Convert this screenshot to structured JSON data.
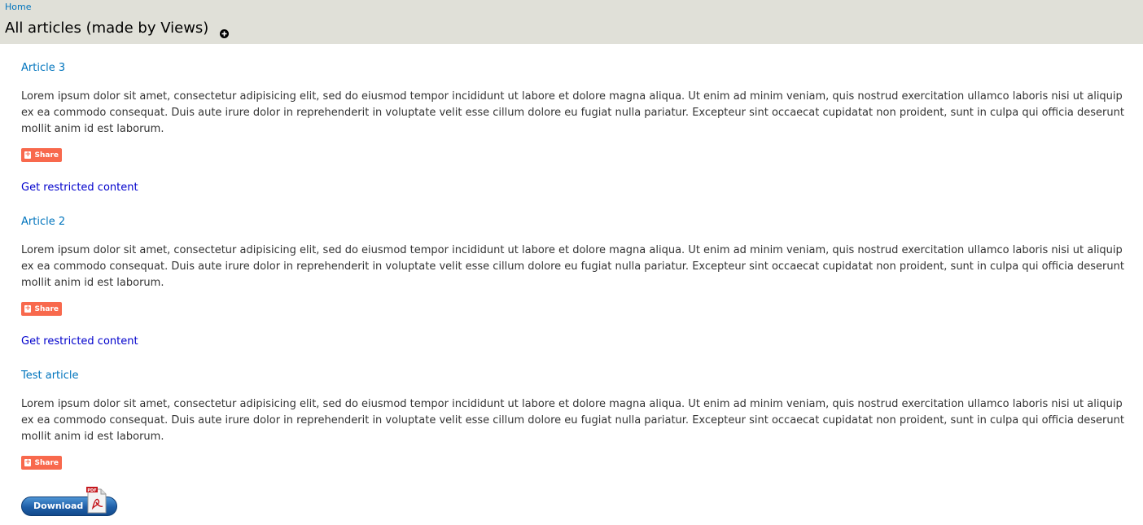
{
  "breadcrumb": {
    "home": "Home"
  },
  "page": {
    "title": "All articles (made by Views)"
  },
  "articles": [
    {
      "title": "Article 3",
      "body": "Lorem ipsum dolor sit amet, consectetur adipisicing elit, sed do eiusmod tempor incididunt ut labore et dolore magna aliqua. Ut enim ad minim veniam, quis nostrud exercitation ullamco laboris nisi ut aliquip ex ea commodo consequat. Duis aute irure dolor in reprehenderit in voluptate velit esse cillum dolore eu fugiat nulla pariatur. Excepteur sint occaecat cupidatat non proident, sunt in culpa qui officia deserunt mollit anim id est laborum.",
      "share_label": "Share",
      "restricted_label": "Get restricted content"
    },
    {
      "title": "Article 2",
      "body": "Lorem ipsum dolor sit amet, consectetur adipisicing elit, sed do eiusmod tempor incididunt ut labore et dolore magna aliqua. Ut enim ad minim veniam, quis nostrud exercitation ullamco laboris nisi ut aliquip ex ea commodo consequat. Duis aute irure dolor in reprehenderit in voluptate velit esse cillum dolore eu fugiat nulla pariatur. Excepteur sint occaecat cupidatat non proident, sunt in culpa qui officia deserunt mollit anim id est laborum.",
      "share_label": "Share",
      "restricted_label": "Get restricted content"
    },
    {
      "title": "Test article",
      "body": "Lorem ipsum dolor sit amet, consectetur adipisicing elit, sed do eiusmod tempor incididunt ut labore et dolore magna aliqua. Ut enim ad minim veniam, quis nostrud exercitation ullamco laboris nisi ut aliquip ex ea commodo consequat. Duis aute irure dolor in reprehenderit in voluptate velit esse cillum dolore eu fugiat nulla pariatur. Excepteur sint occaecat cupidatat non proident, sunt in culpa qui officia deserunt mollit anim id est laborum.",
      "share_label": "Share"
    }
  ],
  "download": {
    "label": "Download",
    "icon": "pdf-icon",
    "icon_text": "PDF"
  },
  "icons": {
    "title_action": "circle-plus-icon",
    "share": "plus-icon"
  },
  "colors": {
    "header_bg": "#e0e0d8",
    "link": "#0074bd",
    "restricted_link": "#0000cc",
    "share_bg": "#f8694d",
    "download_bg": "#1f5fa8"
  }
}
